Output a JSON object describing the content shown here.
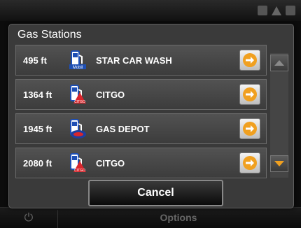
{
  "dialog": {
    "title": "Gas Stations",
    "cancel_label": "Cancel"
  },
  "stations": [
    {
      "distance": "495 ft",
      "name": "STAR CAR WASH",
      "logo": "mobil-pump-icon",
      "logo_text": "Mobil"
    },
    {
      "distance": "1364 ft",
      "name": "CITGO",
      "logo": "citgo-pump-icon",
      "logo_text": "CITGO"
    },
    {
      "distance": "1945 ft",
      "name": "GAS DEPOT",
      "logo": "gas-depot-pump-icon",
      "logo_text": ""
    },
    {
      "distance": "2080 ft",
      "name": "CITGO",
      "logo": "citgo-pump-icon",
      "logo_text": "CITGO"
    }
  ],
  "background": {
    "options_label": "Options"
  },
  "colors": {
    "accent_orange": "#f0a020",
    "scroll_down_orange": "#f0a020",
    "citgo_red": "#d8262c",
    "mobil_blue": "#1e4fb5"
  }
}
